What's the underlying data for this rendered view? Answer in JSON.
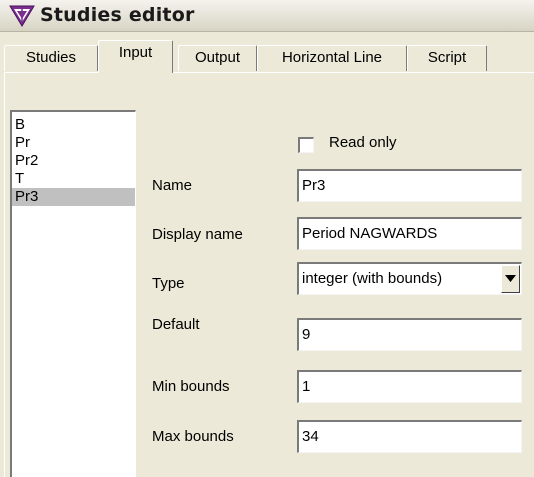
{
  "window": {
    "title": "Studies editor",
    "icon": "studies-logo-icon"
  },
  "tabs": [
    {
      "label": "Studies",
      "active": false
    },
    {
      "label": "Input",
      "active": true
    },
    {
      "label": "Output",
      "active": false
    },
    {
      "label": "Horizontal Line",
      "active": false
    },
    {
      "label": "Script",
      "active": false
    }
  ],
  "inputs_list": [
    {
      "label": "B",
      "selected": false
    },
    {
      "label": "Pr",
      "selected": false
    },
    {
      "label": "Pr2",
      "selected": false
    },
    {
      "label": "T",
      "selected": false
    },
    {
      "label": "Pr3",
      "selected": true
    }
  ],
  "form": {
    "read_only_label": "Read only",
    "read_only_checked": false,
    "name_label": "Name",
    "name_value": "Pr3",
    "display_name_label": "Display name",
    "display_name_value": "Period NAGWARDS",
    "type_label": "Type",
    "type_value": "integer (with bounds)",
    "default_label": "Default",
    "default_value": "9",
    "min_bounds_label": "Min bounds",
    "min_bounds_value": "1",
    "max_bounds_label": "Max bounds",
    "max_bounds_value": "34"
  },
  "colors": {
    "window_bg": "#ece9d8",
    "selected_item": "#c0c0c0",
    "logo": "#7a2f8f"
  }
}
